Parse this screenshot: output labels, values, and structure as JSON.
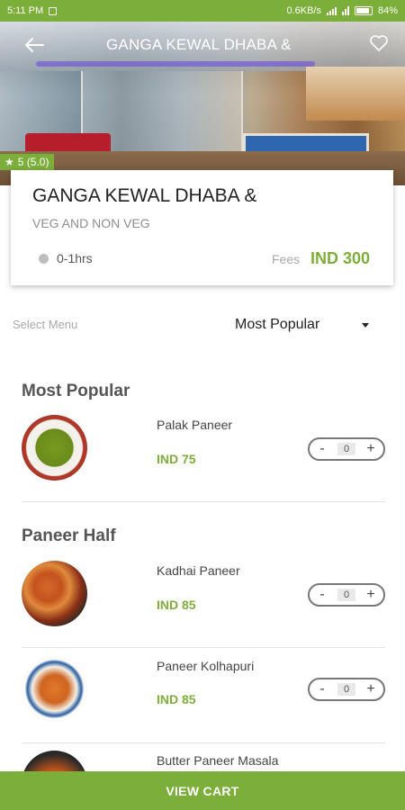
{
  "status_bar": {
    "time": "5:11 PM",
    "network_speed": "0.6KB/s",
    "battery": "84%"
  },
  "restaurant": {
    "header_title": "GANGA KEWAL DHABA &",
    "name": "GANGA KEWAL DHABA &",
    "cuisine": "VEG AND NON VEG",
    "rating": "5 (5.0)",
    "delivery_time": "0-1hrs",
    "fees_label": "Fees",
    "fees_value": "IND 300"
  },
  "menu_select": {
    "label": "Select Menu",
    "selected": "Most Popular"
  },
  "sections": [
    {
      "title": "Most Popular",
      "items": [
        {
          "name": "Palak Paneer",
          "price": "IND 75",
          "qty": "0",
          "image": "palak-paneer"
        }
      ]
    },
    {
      "title": "Paneer Half",
      "items": [
        {
          "name": "Kadhai Paneer",
          "price": "IND 85",
          "qty": "0",
          "image": "kadhai-paneer"
        },
        {
          "name": "Paneer Kolhapuri",
          "price": "IND 85",
          "qty": "0",
          "image": "paneer-kolhapuri"
        },
        {
          "name": "Butter Paneer Masala",
          "image": "butter-paneer-masala"
        }
      ]
    }
  ],
  "stepper_symbols": {
    "minus": "-",
    "plus": "+"
  },
  "footer": {
    "view_cart": "VIEW CART"
  },
  "icons": {
    "back": "arrow-left-icon",
    "favorite": "heart-outline-icon",
    "rating": "star-icon",
    "time": "clock-dot-icon",
    "dropdown": "caret-down-icon"
  },
  "colors": {
    "accent": "#7cae3a",
    "text_dark": "#222222",
    "text_muted": "#8d8d8d"
  }
}
